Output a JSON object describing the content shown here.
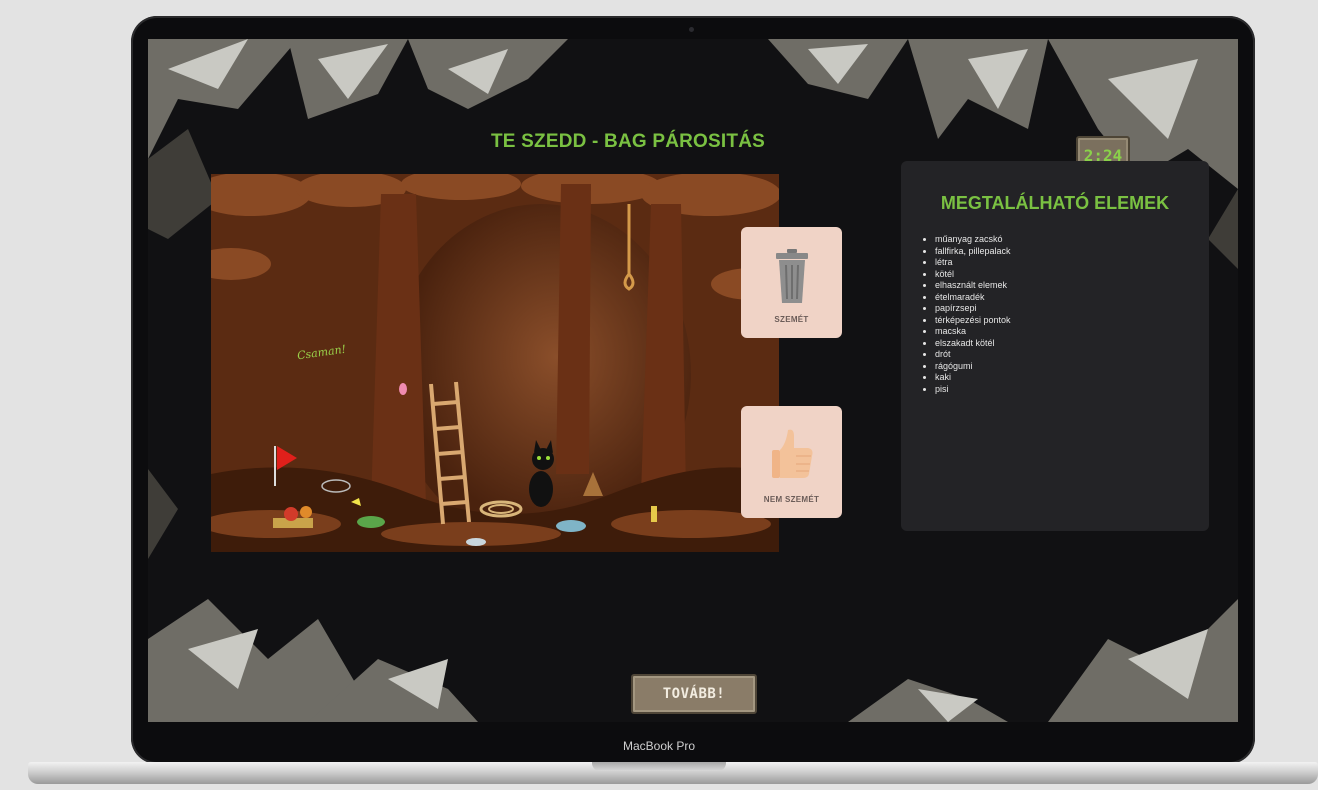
{
  "game": {
    "title": "TE SZEDD - BAG PÁROSITÁS",
    "timer": "2:24",
    "next_button": "TOVÁBB!"
  },
  "cards": {
    "trash_label": "SZEMÉT",
    "not_trash_label": "NEM SZEMÉT"
  },
  "panel": {
    "title": "MEGTALÁLHATÓ ELEMEK",
    "items": [
      "műanyag zacskó",
      "fallfirka, pillepalack",
      "létra",
      "kötél",
      "elhasznált elemek",
      "ételmaradék",
      "papírzsepi",
      "térképezési pontok",
      "macska",
      "elszakadt kötél",
      "drót",
      "rágógumi",
      "kaki",
      "pisi"
    ]
  },
  "scene": {
    "graffiti_text": "Csaman!"
  },
  "device": {
    "brand_label": "MacBook Pro"
  },
  "colors": {
    "accent_green": "#7ac142",
    "card_bg": "#f0d3c6",
    "panel_bg": "#232326",
    "stone_button": "#8a7c68"
  }
}
